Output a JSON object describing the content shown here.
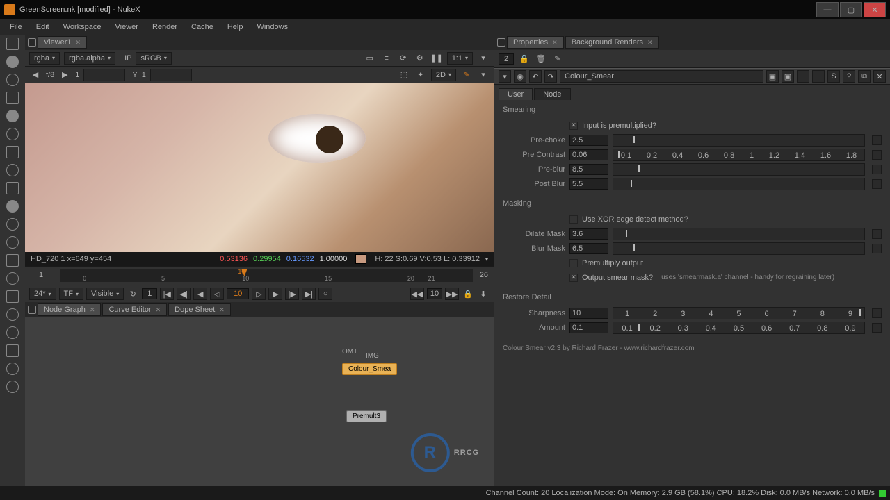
{
  "title": "GreenScreen.nk [modified] - NukeX",
  "menu": [
    "File",
    "Edit",
    "Workspace",
    "Viewer",
    "Render",
    "Cache",
    "Help",
    "Windows"
  ],
  "viewer": {
    "tab": "Viewer1",
    "channel1": "rgba",
    "channel2": "rgba.alpha",
    "ip_label": "IP",
    "colorspace": "sRGB",
    "zoom": "1:1",
    "frame_cur": "f/8",
    "frame_total": "1",
    "y_label": "Y",
    "y_val": "1",
    "mode2d": "2D"
  },
  "info": {
    "clip": "HD_720 1 x=649 y=454",
    "r": "0.53136",
    "g": "0.29954",
    "b": "0.16532",
    "a": "1.00000",
    "right": "H: 22 S:0.69 V:0.53 L: 0.33912"
  },
  "timeline": {
    "start": "1",
    "end": "26",
    "ticks": [
      "0",
      "5",
      "10",
      "15",
      "20",
      "21"
    ],
    "cur": "10"
  },
  "transport": {
    "fps": "24*",
    "tf": "TF",
    "visible": "Visible",
    "inframe": "1",
    "curframe": "10",
    "step": "10"
  },
  "tabs_lower": [
    "Node Graph",
    "Curve Editor",
    "Dope Sheet"
  ],
  "nodegraph": {
    "in1": "OMT",
    "in2": "IMG",
    "node1": "Colour_Smea",
    "node2": "Premult3"
  },
  "props": {
    "header_count": "2",
    "tab": "Properties",
    "tab2": "Background Renders",
    "nodename": "Colour_Smear",
    "tab_user": "User",
    "tab_node": "Node",
    "sec_smear": "Smearing",
    "premult_label": "Input is premultiplied?",
    "prechoke_l": "Pre-choke",
    "prechoke_v": "2.5",
    "precontrast_l": "Pre Contrast",
    "precontrast_v": "0.06",
    "preblur_l": "Pre-blur",
    "preblur_v": "8.5",
    "postblur_l": "Post Blur",
    "postblur_v": "5.5",
    "sec_mask": "Masking",
    "xor_label": "Use XOR edge detect method?",
    "dilate_l": "Dilate Mask",
    "dilate_v": "3.6",
    "blurmask_l": "Blur Mask",
    "blurmask_v": "6.5",
    "premultout_label": "Premultiply output",
    "outsmear_label": "Output smear mask?",
    "outsmear_note": "uses 'smearmask.a' channel - handy for regraining later)",
    "sec_restore": "Restore Detail",
    "sharp_l": "Sharpness",
    "sharp_v": "10",
    "amount_l": "Amount",
    "amount_v": "0.1",
    "credits": "Colour Smear v2.3 by Richard Frazer - www.richardfrazer.com"
  },
  "status": "Channel Count: 20 Localization Mode: On Memory: 2.9 GB (58.1%) CPU: 18.2% Disk: 0.0 MB/s Network: 0.0 MB/s"
}
